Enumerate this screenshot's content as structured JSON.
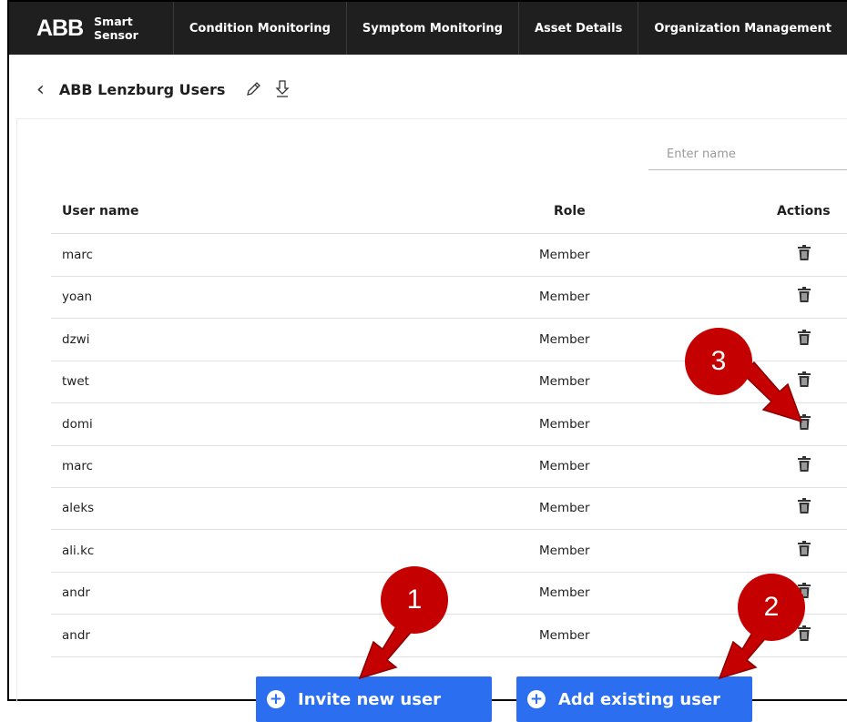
{
  "nav": {
    "brand_logo": "ABB",
    "brand_text": "Smart Sensor",
    "tabs": [
      "Condition Monitoring",
      "Symptom Monitoring",
      "Asset Details",
      "Organization Management"
    ]
  },
  "header": {
    "title": "ABB Lenzburg Users"
  },
  "search": {
    "placeholder": "Enter name"
  },
  "table": {
    "columns": [
      "User name",
      "Role",
      "Actions"
    ],
    "rows": [
      {
        "user": "marc",
        "role": "Member"
      },
      {
        "user": "yoan",
        "role": "Member"
      },
      {
        "user": "dzwi",
        "role": "Member"
      },
      {
        "user": "twet",
        "role": "Member"
      },
      {
        "user": "domi",
        "role": "Member"
      },
      {
        "user": "marc",
        "role": "Member"
      },
      {
        "user": "aleks",
        "role": "Member"
      },
      {
        "user": "ali.kc",
        "role": "Member"
      },
      {
        "user": "andr",
        "role": "Member"
      },
      {
        "user": "andr",
        "role": "Member"
      }
    ]
  },
  "buttons": {
    "invite": "Invite new user",
    "add_existing": "Add existing user"
  },
  "annotations": [
    "1",
    "2",
    "3"
  ],
  "colors": {
    "nav_bg": "#1f1f1f",
    "primary": "#2b6ff0",
    "annotation": "#c50000"
  }
}
